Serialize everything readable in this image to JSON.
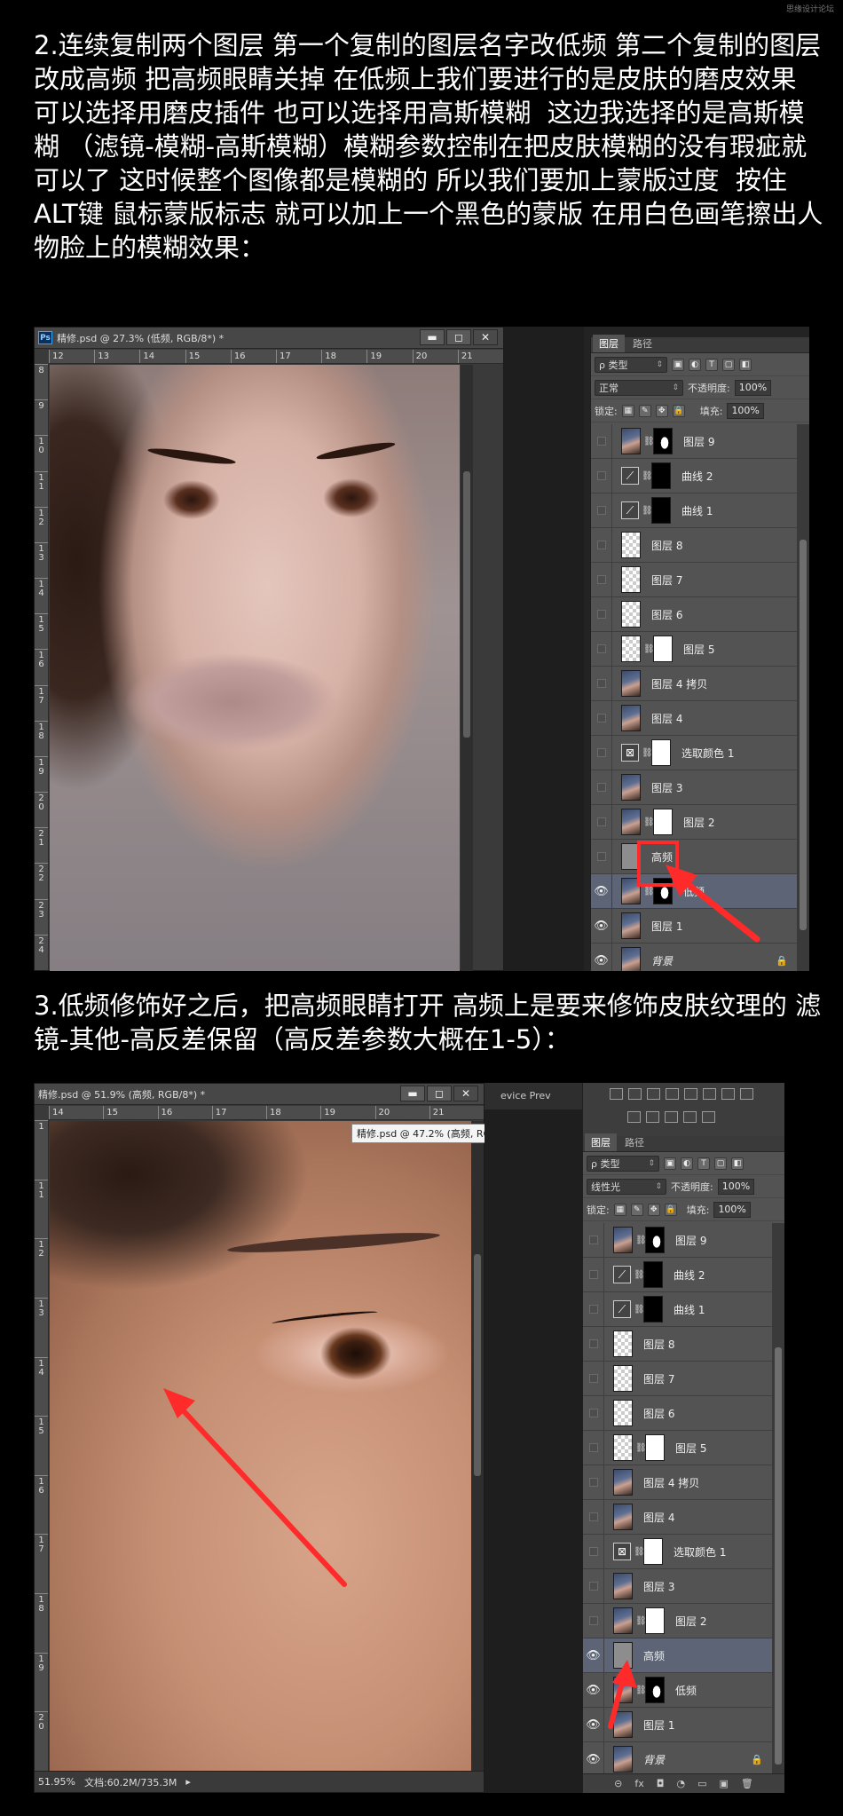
{
  "watermark": "思缘设计论坛",
  "step2_text": "2.连续复制两个图层 第一个复制的图层名字改低频 第二个复制的图层改成高频 把高频眼睛关掉 在低频上我们要进行的是皮肤的磨皮效果 可以选择用磨皮插件 也可以选择用高斯模糊  这边我选择的是高斯模糊 （滤镜-模糊-高斯模糊）模糊参数控制在把皮肤模糊的没有瑕疵就可以了 这时候整个图像都是模糊的 所以我们要加上蒙版过度  按住ALT键 鼠标蒙版标志 就可以加上一个黑色的蒙版 在用白色画笔擦出人物脸上的模糊效果：",
  "step3_text": "3.低频修饰好之后，把高频眼睛打开 高频上是要来修饰皮肤纹理的 滤镜-其他-高反差保留（高反差参数大概在1-5）：",
  "shot1": {
    "doc_title": "精修.psd @ 27.3% (低频, RGB/8*) *",
    "ps_badge": "Ps",
    "ruler_h": [
      "12",
      "13",
      "14",
      "15",
      "16",
      "17",
      "18",
      "19",
      "20",
      "21"
    ],
    "ruler_v": [
      "8",
      "9",
      "1\n0",
      "1\n1",
      "1\n2",
      "1\n3",
      "1\n4",
      "1\n5",
      "1\n6",
      "1\n7",
      "1\n8",
      "1\n9",
      "2\n0",
      "2\n1",
      "2\n2",
      "2\n3",
      "2\n4"
    ],
    "win_min": "▬",
    "win_max": "◻",
    "win_close": "✕",
    "panel": {
      "tabs": [
        "图层",
        "路径"
      ],
      "filter": "ρ 类型",
      "blend": "正常",
      "opacity_label": "不透明度:",
      "opacity": "100%",
      "lock_label": "锁定:",
      "fill_label": "填充:",
      "fill": "100%",
      "layers": [
        {
          "name": "图层 9",
          "type": "photo-mask",
          "visible": false
        },
        {
          "name": "曲线 2",
          "type": "curve-black",
          "visible": false
        },
        {
          "name": "曲线 1",
          "type": "curve-black",
          "visible": false
        },
        {
          "name": "图层 8",
          "type": "trans",
          "visible": false
        },
        {
          "name": "图层 7",
          "type": "trans",
          "visible": false
        },
        {
          "name": "图层 6",
          "type": "trans",
          "visible": false
        },
        {
          "name": "图层 5",
          "type": "trans-white",
          "visible": false
        },
        {
          "name": "图层 4 拷贝",
          "type": "photo",
          "visible": false
        },
        {
          "name": "图层 4",
          "type": "photo",
          "visible": false
        },
        {
          "name": "选取颜色 1",
          "type": "adj-white",
          "visible": false
        },
        {
          "name": "图层 3",
          "type": "photo",
          "visible": false
        },
        {
          "name": "图层 2",
          "type": "photo-white",
          "visible": false
        },
        {
          "name": "高频",
          "type": "gray",
          "visible": false
        },
        {
          "name": "低频",
          "type": "photo-mask",
          "visible": true,
          "active": true
        },
        {
          "name": "图层 1",
          "type": "photo",
          "visible": true
        },
        {
          "name": "背景",
          "type": "photo",
          "visible": true,
          "locked": true
        }
      ]
    }
  },
  "shot2": {
    "doc_title": "精修.psd @ 51.9% (高频, RGB/8*) *",
    "tooltip": "精修.psd @ 47.2% (高频, RGB/8*) *",
    "side_tab": "evice Prev",
    "ruler_h": [
      "14",
      "15",
      "16",
      "17",
      "18",
      "19",
      "20",
      "21"
    ],
    "ruler_v": [
      "1",
      "1\n1",
      "1\n2",
      "1\n3",
      "1\n4",
      "1\n5",
      "1\n6",
      "1\n7",
      "1\n8",
      "1\n9",
      "2\n0"
    ],
    "zoom": "51.95%",
    "doc_info": "文档:60.2M/735.3M",
    "panel": {
      "tabs": [
        "图层",
        "路径"
      ],
      "filter": "ρ 类型",
      "blend": "线性光",
      "opacity_label": "不透明度:",
      "opacity": "100%",
      "lock_label": "锁定:",
      "fill_label": "填充:",
      "fill": "100%",
      "bottom_icons": [
        "⊝",
        "fx",
        "◘",
        "◔",
        "▭",
        "▣",
        "🗑"
      ],
      "layers": [
        {
          "name": "图层 9",
          "type": "photo-mask",
          "visible": false
        },
        {
          "name": "曲线 2",
          "type": "curve-black",
          "visible": false
        },
        {
          "name": "曲线 1",
          "type": "curve-black",
          "visible": false
        },
        {
          "name": "图层 8",
          "type": "trans",
          "visible": false
        },
        {
          "name": "图层 7",
          "type": "trans",
          "visible": false
        },
        {
          "name": "图层 6",
          "type": "trans",
          "visible": false
        },
        {
          "name": "图层 5",
          "type": "trans-white",
          "visible": false
        },
        {
          "name": "图层 4 拷贝",
          "type": "photo",
          "visible": false
        },
        {
          "name": "图层 4",
          "type": "photo",
          "visible": false
        },
        {
          "name": "选取颜色 1",
          "type": "adj-white",
          "visible": false
        },
        {
          "name": "图层 3",
          "type": "photo",
          "visible": false
        },
        {
          "name": "图层 2",
          "type": "photo-white",
          "visible": false
        },
        {
          "name": "高频",
          "type": "gray",
          "visible": true,
          "active": true
        },
        {
          "name": "低频",
          "type": "photo-mask",
          "visible": true
        },
        {
          "name": "图层 1",
          "type": "photo",
          "visible": true
        },
        {
          "name": "背景",
          "type": "photo",
          "visible": true,
          "locked": true
        }
      ]
    }
  },
  "colors": {
    "accent_red": "#ff2a2a",
    "active_layer": "#5c6476",
    "panel_bg": "#535353"
  }
}
